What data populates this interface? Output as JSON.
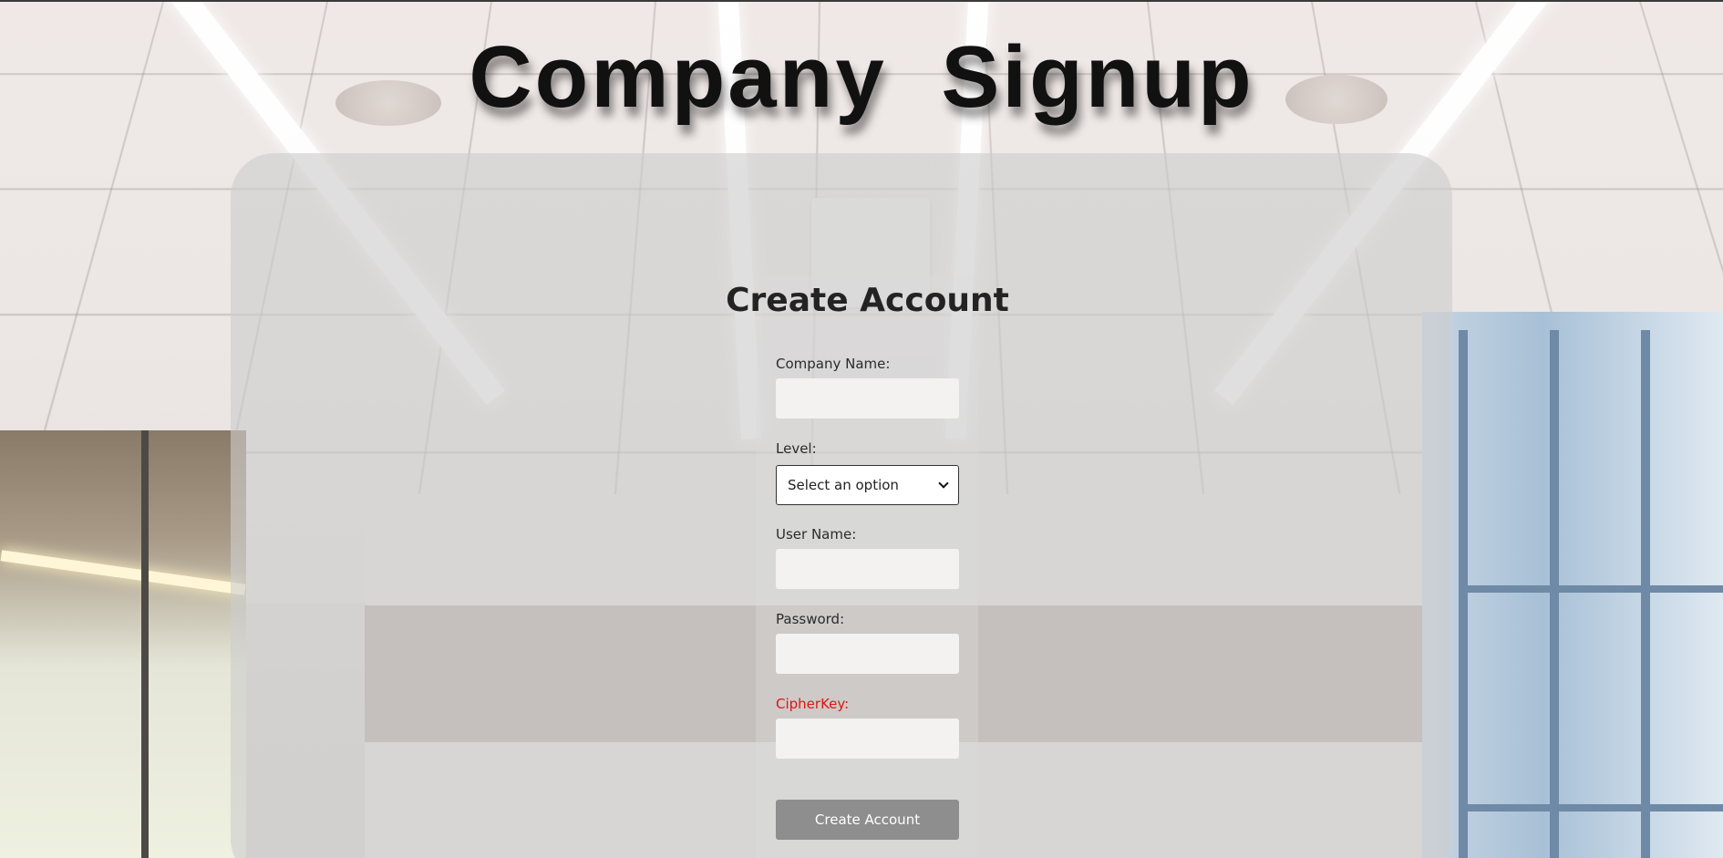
{
  "page": {
    "title": "Company  Signup"
  },
  "form": {
    "heading": "Create Account",
    "company_name": {
      "label": "Company Name:",
      "value": ""
    },
    "level": {
      "label": "Level:",
      "selected": "Select an option"
    },
    "user_name": {
      "label": "User Name:",
      "value": ""
    },
    "password": {
      "label": "Password:",
      "value": ""
    },
    "cipher_key": {
      "label": "CipherKey:",
      "value": "",
      "label_color": "#e01414"
    },
    "submit_label": "Create Account"
  },
  "icons": {
    "select_arrow": "chevron-down-icon"
  },
  "colors": {
    "button_bg": "#8e8e8e",
    "panel_bg": "rgba(205,205,205,0.62)",
    "accent_warning": "#e01414"
  }
}
